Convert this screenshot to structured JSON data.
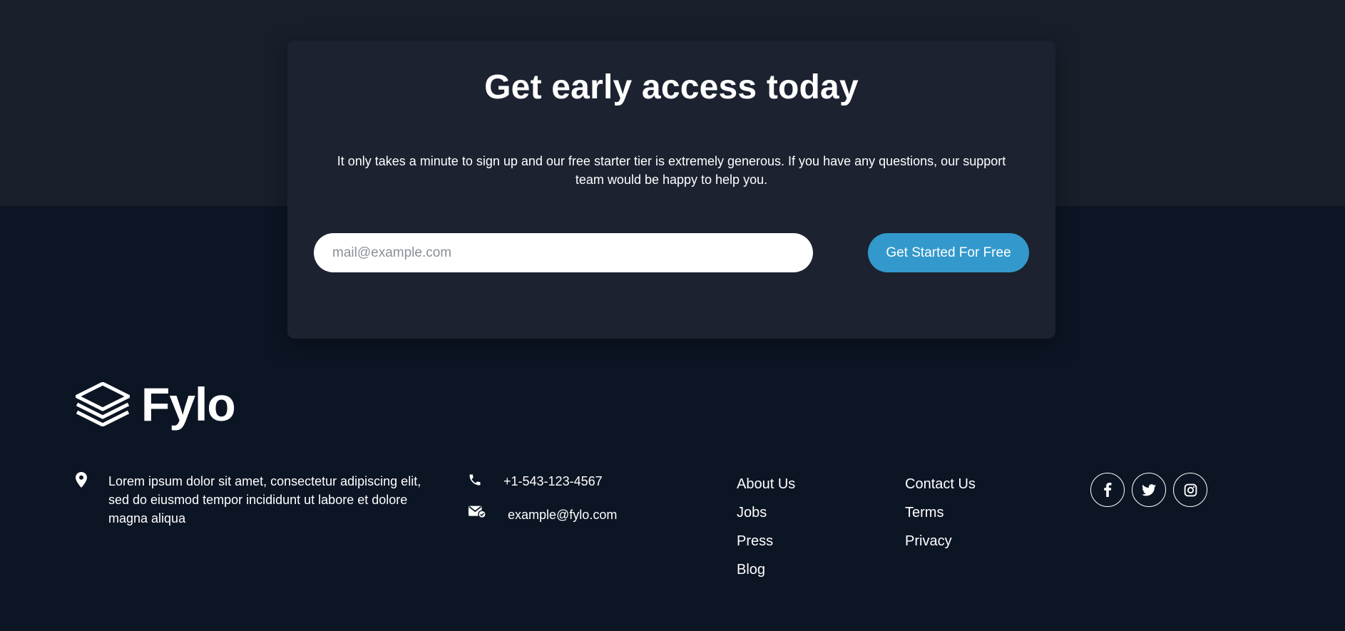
{
  "cta": {
    "title": "Get early access today",
    "text": "It only takes a minute to sign up and our free starter tier is extremely generous. If you have any questions, our support team would be happy to help you.",
    "email_placeholder": "mail@example.com",
    "button_label": "Get Started For Free"
  },
  "footer": {
    "logo_text": "Fylo",
    "address": "Lorem ipsum dolor sit amet, consectetur adipiscing elit, sed do eiusmod tempor incididunt ut labore et dolore magna aliqua",
    "phone": "+1-543-123-4567",
    "email": "example@fylo.com",
    "links_col1": [
      "About Us",
      "Jobs",
      "Press",
      "Blog"
    ],
    "links_col2": [
      "Contact Us",
      "Terms",
      "Privacy"
    ],
    "socials": [
      "facebook-icon",
      "twitter-icon",
      "instagram-icon"
    ]
  },
  "colors": {
    "top_band": "#181f2a",
    "page_bg": "#0c1524",
    "card_bg": "#1c2230",
    "accent": "#3399cc"
  }
}
